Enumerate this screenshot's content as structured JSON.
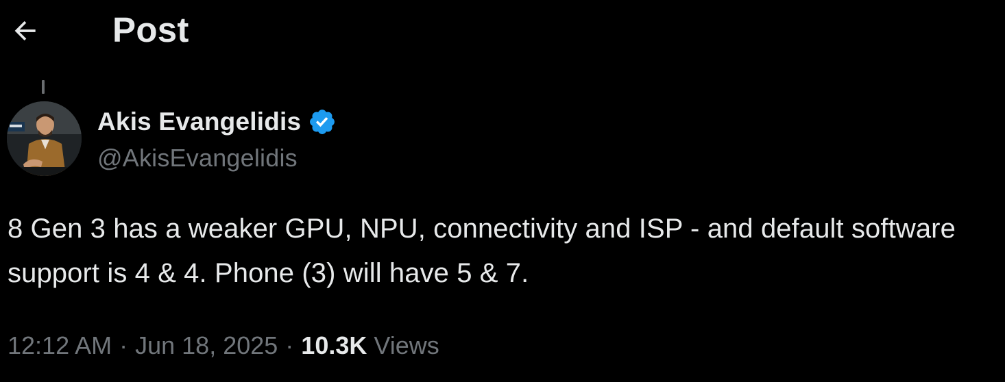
{
  "header": {
    "title": "Post",
    "back_icon": "arrow-left-icon"
  },
  "author": {
    "name": "Akis Evangelidis",
    "handle": "@AkisEvangelidis",
    "verified_icon": "verified-badge-icon",
    "verified_color": "#1d9bf0",
    "avatar_icon": "avatar-photo"
  },
  "post": {
    "text": "8 Gen 3 has a weaker GPU, NPU, connectivity and ISP - and default software support is 4 & 4. Phone (3) will have 5 & 7."
  },
  "meta": {
    "time": "12:12 AM",
    "date": "Jun 18, 2025",
    "separator": "·",
    "views_count": "10.3K",
    "views_label": "Views"
  },
  "colors": {
    "background": "#000000",
    "primary_text": "#e7e9ea",
    "secondary_text": "#71767b"
  }
}
